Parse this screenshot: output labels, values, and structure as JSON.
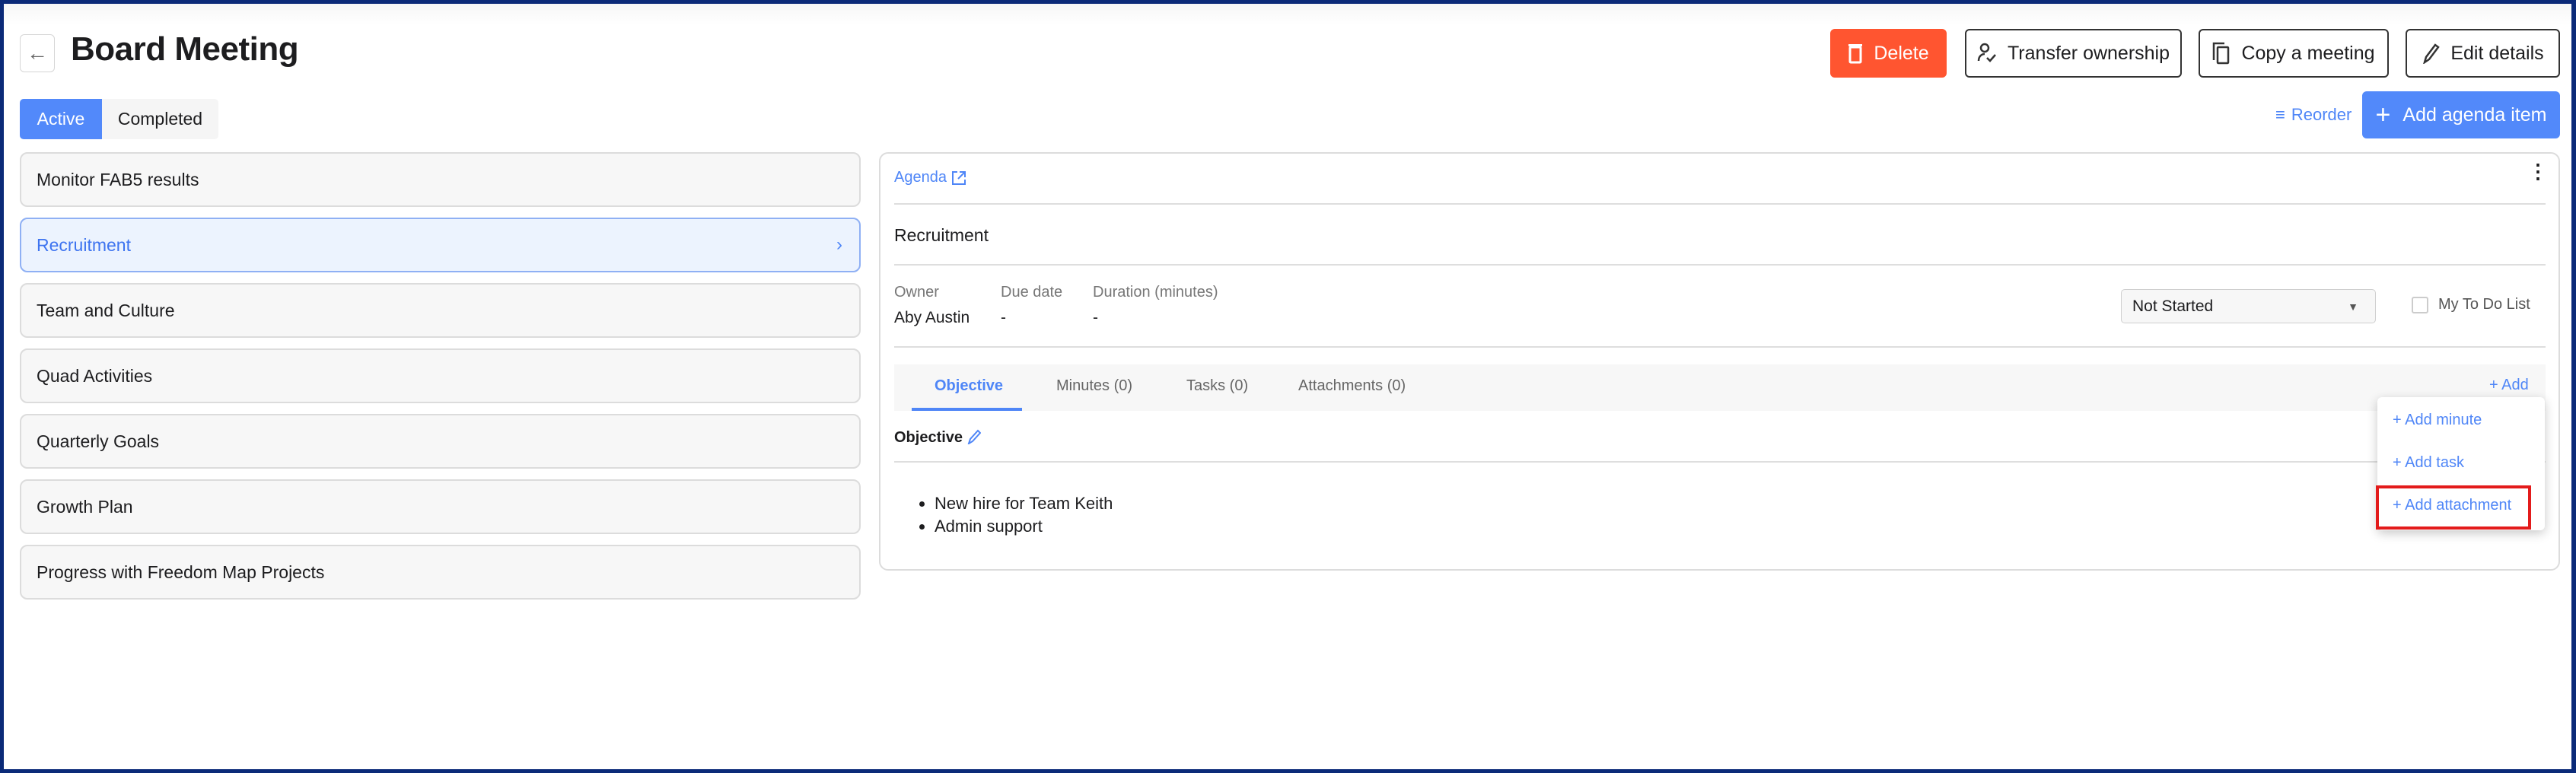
{
  "header": {
    "title": "Board Meeting",
    "back_icon": "arrow-left-icon"
  },
  "actions": {
    "delete": "Delete",
    "transfer": "Transfer ownership",
    "copy": "Copy a meeting",
    "edit": "Edit details"
  },
  "filter_tabs": {
    "active": "Active",
    "completed": "Completed"
  },
  "toolbar": {
    "reorder": "Reorder",
    "add_agenda_item": "Add agenda item"
  },
  "agenda_items": [
    "Monitor FAB5 results",
    "Recruitment",
    "Team and Culture",
    "Quad Activities",
    "Quarterly Goals",
    "Growth Plan",
    "Progress with Freedom Map Projects"
  ],
  "detail": {
    "agenda_link": "Agenda",
    "item_title": "Recruitment",
    "owner_label": "Owner",
    "owner": "Aby Austin",
    "due_label": "Due date",
    "due": "-",
    "duration_label": "Duration (minutes)",
    "duration": "-",
    "status": "Not Started",
    "todo_label": "My To Do List",
    "tabs": [
      "Objective",
      "Minutes (0)",
      "Tasks (0)",
      "Attachments (0)"
    ],
    "add": "+ Add",
    "objective_heading": "Objective",
    "objective_bullets": [
      "New hire for Team Keith",
      "Admin support"
    ],
    "add_menu": [
      "+ Add minute",
      "+ Add task",
      "+ Add attachment"
    ]
  },
  "colors": {
    "primary": "#5289fa",
    "danger": "#ff5530",
    "highlight": "#e31b1b"
  }
}
